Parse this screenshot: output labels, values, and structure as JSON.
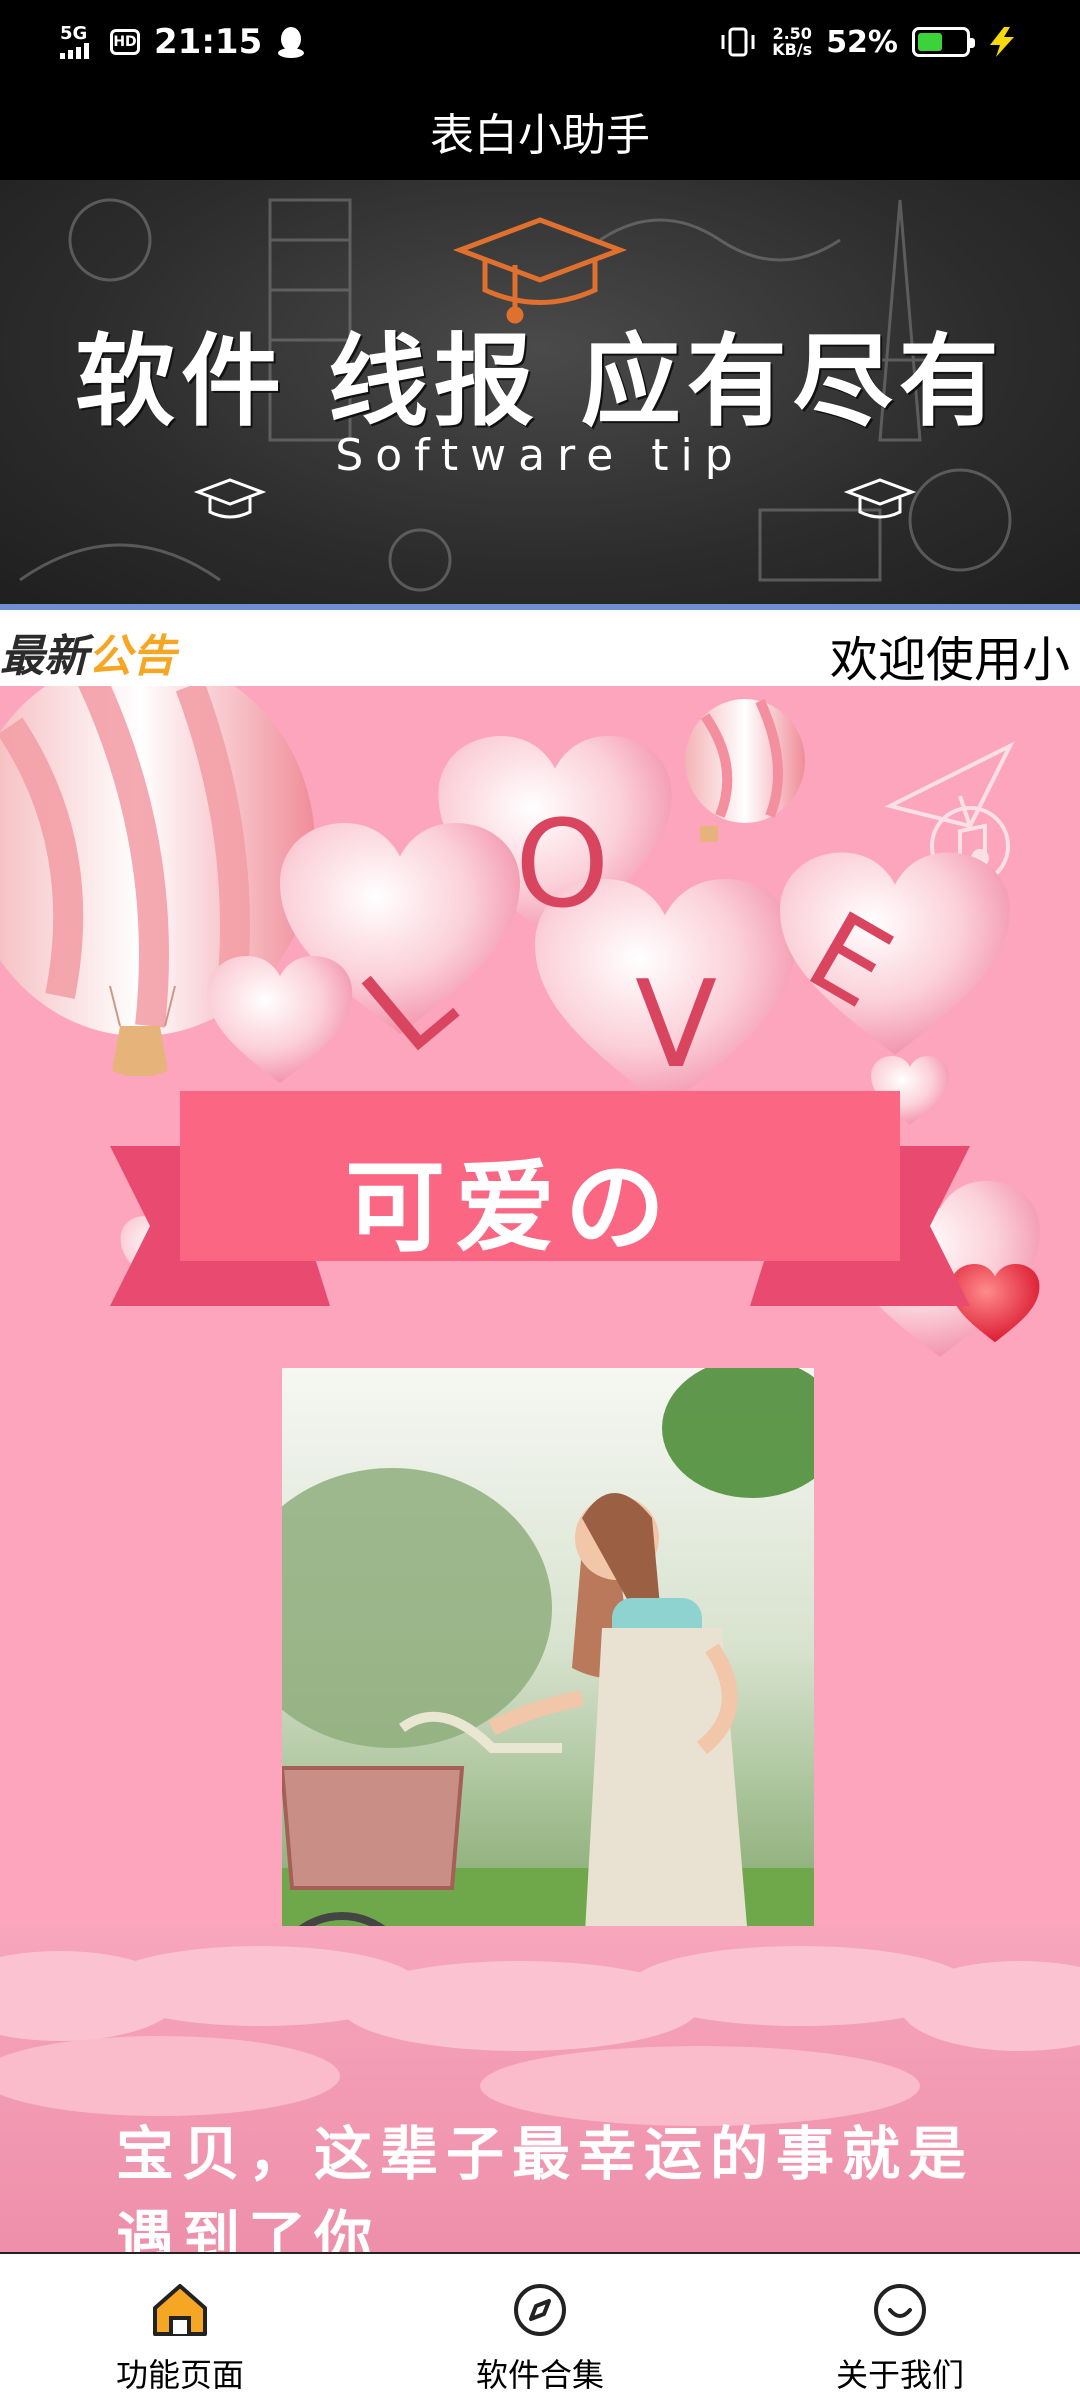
{
  "status_bar": {
    "network": "5G",
    "hd": "HD",
    "time": "21:15",
    "speed_value": "2.50",
    "speed_unit": "KB/s",
    "battery_percent": "52%",
    "battery_level": 0.52,
    "icons": [
      "signal-icon",
      "qq-icon",
      "vibrate-icon",
      "battery-icon",
      "charging-icon"
    ]
  },
  "app_bar": {
    "title": "表白小助手"
  },
  "banner": {
    "title": "软件 线报 应有尽有",
    "subtitle": "Software tip"
  },
  "notice": {
    "label_part1": "最新",
    "label_part2": "公告",
    "text": "欢迎使用小"
  },
  "card": {
    "love_letters": [
      "L",
      "O",
      "V",
      "E"
    ],
    "ribbon_text": "可爱の",
    "quote": "宝贝，这辈子最幸运的事就是遇到了你"
  },
  "bottom_nav": {
    "items": [
      {
        "label": "功能页面",
        "icon": "home-icon"
      },
      {
        "label": "软件合集",
        "icon": "compass-icon"
      },
      {
        "label": "关于我们",
        "icon": "smile-icon"
      }
    ],
    "accent": "#f5a623"
  }
}
